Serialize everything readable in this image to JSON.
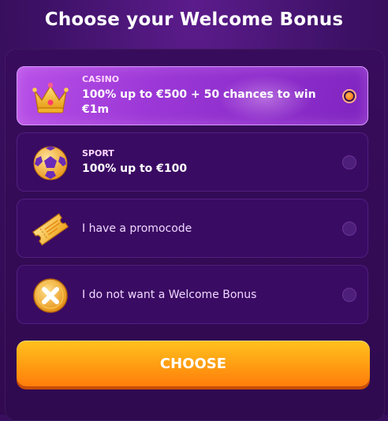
{
  "header": {
    "title": "Choose your Welcome Bonus"
  },
  "options": [
    {
      "category": "CASINO",
      "title": "100% up to €500 + 50 chances to win €1m",
      "icon": "crown-icon",
      "selected": true
    },
    {
      "category": "SPORT",
      "title": "100% up to €100",
      "icon": "soccer-ball-icon",
      "selected": false
    },
    {
      "title": "I have a promocode",
      "icon": "ticket-icon",
      "selected": false
    },
    {
      "title": "I do not want a Welcome Bonus",
      "icon": "x-coin-icon",
      "selected": false
    }
  ],
  "actions": {
    "choose_label": "CHOOSE"
  },
  "colors": {
    "background": "#3d1166",
    "selected_option": "#9b37d6",
    "button": "#ff9c12",
    "radio_checked": "#ff6a10"
  }
}
